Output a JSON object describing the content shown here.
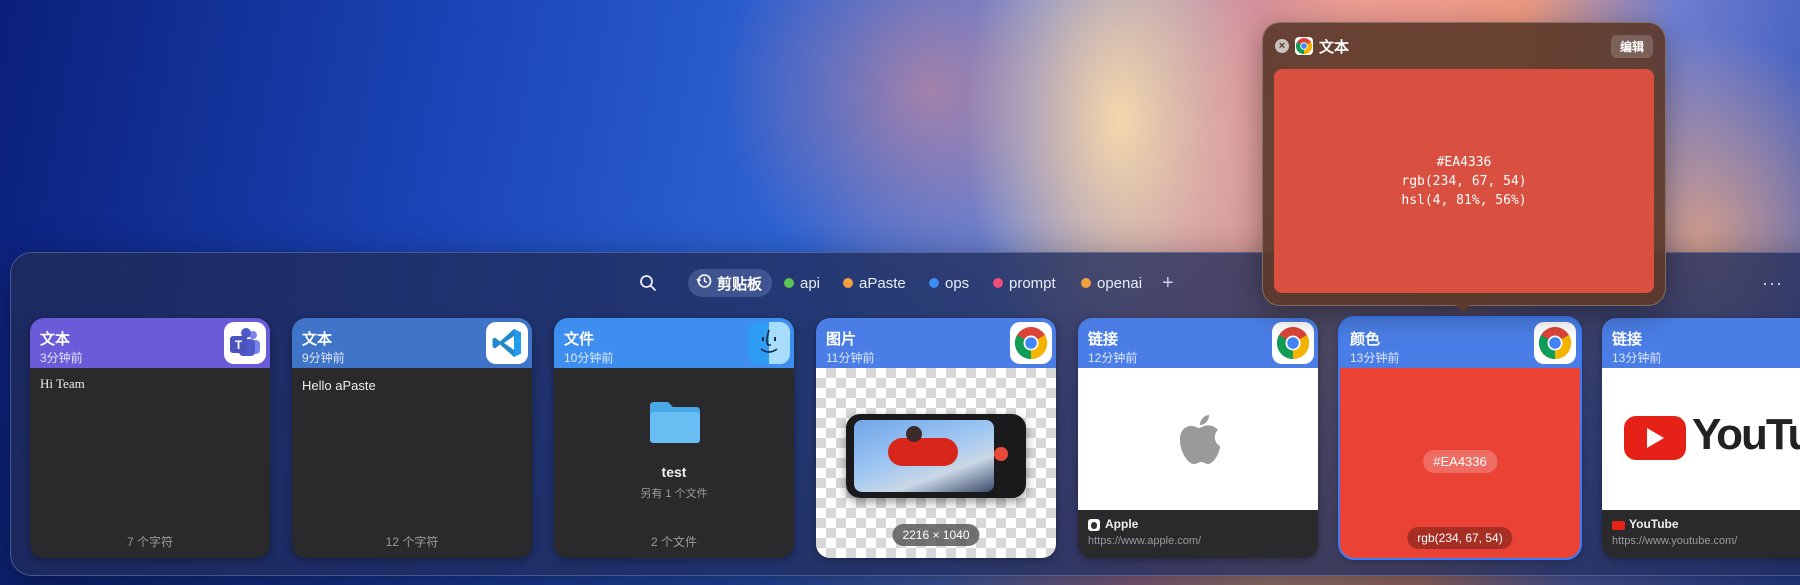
{
  "toolbar": {
    "search_icon": "search-icon",
    "tabs": [
      {
        "label": "剪贴板",
        "icon": "history-icon",
        "active": true
      },
      {
        "label": "api",
        "dot_color": "#5cc456"
      },
      {
        "label": "aPaste",
        "dot_color": "#f0a040"
      },
      {
        "label": "ops",
        "dot_color": "#3b8cf0"
      },
      {
        "label": "prompt",
        "dot_color": "#ef4a7a"
      },
      {
        "label": "openai",
        "dot_color": "#f0a040"
      }
    ],
    "add_icon": "plus-icon",
    "more_icon": "ellipsis-icon"
  },
  "popup": {
    "title": "文本",
    "edit_label": "编辑",
    "app_icon": "chrome-icon",
    "color_hex": "#EA4336",
    "lines": [
      "#EA4336",
      "rgb(234, 67, 54)",
      "hsl(4, 81%, 56%)"
    ]
  },
  "cards": [
    {
      "title": "文本",
      "time": "3分钟前",
      "app": "teams-icon",
      "head_color": "#6a5cd8",
      "content": "Hi Team",
      "footer": "7 个字符"
    },
    {
      "title": "文本",
      "time": "9分钟前",
      "app": "vscode-icon",
      "head_color": "#3f74c9",
      "content": "Hello aPaste",
      "footer": "12 个字符"
    },
    {
      "title": "文件",
      "time": "10分钟前",
      "app": "finder-icon",
      "head_color": "#3e8ef0",
      "file_name": "test",
      "file_sub": "另有 1 个文件",
      "footer": "2 个文件"
    },
    {
      "title": "图片",
      "time": "11分钟前",
      "app": "chrome-icon",
      "head_color": "#4a7ee6",
      "dimensions": "2216 × 1040"
    },
    {
      "title": "链接",
      "time": "12分钟前",
      "app": "chrome-icon",
      "head_color": "#4a7ee6",
      "link_title": "Apple",
      "link_url": "https://www.apple.com/",
      "site_icon": "apple-logo-icon"
    },
    {
      "title": "颜色",
      "time": "13分钟前",
      "app": "chrome-icon",
      "head_color": "#4a7ee6",
      "color_hex": "#EA4336",
      "color_rgb": "rgb(234, 67, 54)",
      "selected": true
    },
    {
      "title": "链接",
      "time": "13分钟前",
      "app": "chrome-icon",
      "head_color": "#4a7ee6",
      "link_title": "YouTube",
      "link_url": "https://www.youtube.com/",
      "site_icon": "youtube-logo-icon",
      "banner_text": "YouTube"
    }
  ],
  "colors": {
    "accent": "#3b7cf6",
    "picked_color": "#EA4336",
    "card_bg": "#2a2a2c"
  }
}
